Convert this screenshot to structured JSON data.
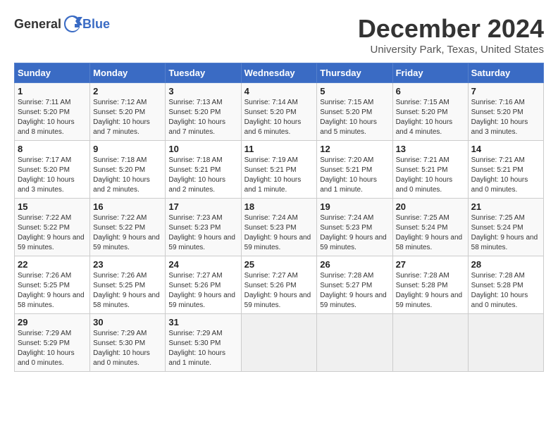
{
  "header": {
    "logo_general": "General",
    "logo_blue": "Blue",
    "month_title": "December 2024",
    "location": "University Park, Texas, United States"
  },
  "days_of_week": [
    "Sunday",
    "Monday",
    "Tuesday",
    "Wednesday",
    "Thursday",
    "Friday",
    "Saturday"
  ],
  "weeks": [
    [
      {
        "day": "1",
        "sunrise": "7:11 AM",
        "sunset": "5:20 PM",
        "daylight": "10 hours and 8 minutes."
      },
      {
        "day": "2",
        "sunrise": "7:12 AM",
        "sunset": "5:20 PM",
        "daylight": "10 hours and 7 minutes."
      },
      {
        "day": "3",
        "sunrise": "7:13 AM",
        "sunset": "5:20 PM",
        "daylight": "10 hours and 7 minutes."
      },
      {
        "day": "4",
        "sunrise": "7:14 AM",
        "sunset": "5:20 PM",
        "daylight": "10 hours and 6 minutes."
      },
      {
        "day": "5",
        "sunrise": "7:15 AM",
        "sunset": "5:20 PM",
        "daylight": "10 hours and 5 minutes."
      },
      {
        "day": "6",
        "sunrise": "7:15 AM",
        "sunset": "5:20 PM",
        "daylight": "10 hours and 4 minutes."
      },
      {
        "day": "7",
        "sunrise": "7:16 AM",
        "sunset": "5:20 PM",
        "daylight": "10 hours and 3 minutes."
      }
    ],
    [
      {
        "day": "8",
        "sunrise": "7:17 AM",
        "sunset": "5:20 PM",
        "daylight": "10 hours and 3 minutes."
      },
      {
        "day": "9",
        "sunrise": "7:18 AM",
        "sunset": "5:20 PM",
        "daylight": "10 hours and 2 minutes."
      },
      {
        "day": "10",
        "sunrise": "7:18 AM",
        "sunset": "5:21 PM",
        "daylight": "10 hours and 2 minutes."
      },
      {
        "day": "11",
        "sunrise": "7:19 AM",
        "sunset": "5:21 PM",
        "daylight": "10 hours and 1 minute."
      },
      {
        "day": "12",
        "sunrise": "7:20 AM",
        "sunset": "5:21 PM",
        "daylight": "10 hours and 1 minute."
      },
      {
        "day": "13",
        "sunrise": "7:21 AM",
        "sunset": "5:21 PM",
        "daylight": "10 hours and 0 minutes."
      },
      {
        "day": "14",
        "sunrise": "7:21 AM",
        "sunset": "5:21 PM",
        "daylight": "10 hours and 0 minutes."
      }
    ],
    [
      {
        "day": "15",
        "sunrise": "7:22 AM",
        "sunset": "5:22 PM",
        "daylight": "9 hours and 59 minutes."
      },
      {
        "day": "16",
        "sunrise": "7:22 AM",
        "sunset": "5:22 PM",
        "daylight": "9 hours and 59 minutes."
      },
      {
        "day": "17",
        "sunrise": "7:23 AM",
        "sunset": "5:23 PM",
        "daylight": "9 hours and 59 minutes."
      },
      {
        "day": "18",
        "sunrise": "7:24 AM",
        "sunset": "5:23 PM",
        "daylight": "9 hours and 59 minutes."
      },
      {
        "day": "19",
        "sunrise": "7:24 AM",
        "sunset": "5:23 PM",
        "daylight": "9 hours and 59 minutes."
      },
      {
        "day": "20",
        "sunrise": "7:25 AM",
        "sunset": "5:24 PM",
        "daylight": "9 hours and 58 minutes."
      },
      {
        "day": "21",
        "sunrise": "7:25 AM",
        "sunset": "5:24 PM",
        "daylight": "9 hours and 58 minutes."
      }
    ],
    [
      {
        "day": "22",
        "sunrise": "7:26 AM",
        "sunset": "5:25 PM",
        "daylight": "9 hours and 58 minutes."
      },
      {
        "day": "23",
        "sunrise": "7:26 AM",
        "sunset": "5:25 PM",
        "daylight": "9 hours and 58 minutes."
      },
      {
        "day": "24",
        "sunrise": "7:27 AM",
        "sunset": "5:26 PM",
        "daylight": "9 hours and 59 minutes."
      },
      {
        "day": "25",
        "sunrise": "7:27 AM",
        "sunset": "5:26 PM",
        "daylight": "9 hours and 59 minutes."
      },
      {
        "day": "26",
        "sunrise": "7:28 AM",
        "sunset": "5:27 PM",
        "daylight": "9 hours and 59 minutes."
      },
      {
        "day": "27",
        "sunrise": "7:28 AM",
        "sunset": "5:28 PM",
        "daylight": "9 hours and 59 minutes."
      },
      {
        "day": "28",
        "sunrise": "7:28 AM",
        "sunset": "5:28 PM",
        "daylight": "10 hours and 0 minutes."
      }
    ],
    [
      {
        "day": "29",
        "sunrise": "7:29 AM",
        "sunset": "5:29 PM",
        "daylight": "10 hours and 0 minutes."
      },
      {
        "day": "30",
        "sunrise": "7:29 AM",
        "sunset": "5:30 PM",
        "daylight": "10 hours and 0 minutes."
      },
      {
        "day": "31",
        "sunrise": "7:29 AM",
        "sunset": "5:30 PM",
        "daylight": "10 hours and 1 minute."
      },
      null,
      null,
      null,
      null
    ]
  ],
  "labels": {
    "sunrise": "Sunrise:",
    "sunset": "Sunset:",
    "daylight": "Daylight:"
  }
}
